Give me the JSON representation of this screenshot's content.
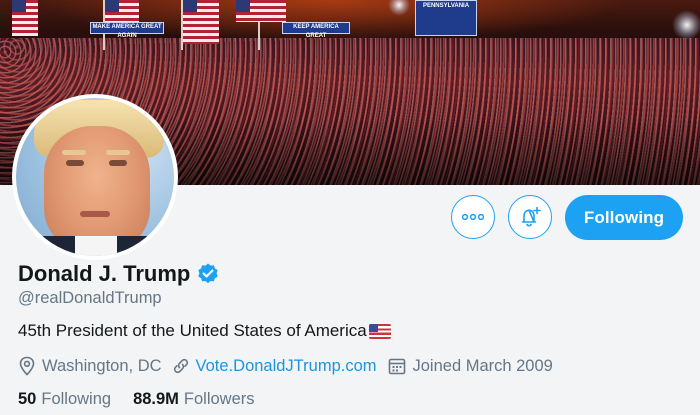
{
  "banner": {
    "signs": [
      "PENNSYLVANIA",
      "MAKE AMERICA GREAT AGAIN",
      "KEEP AMERICA GREAT"
    ]
  },
  "actions": {
    "more_icon": "more-dots-icon",
    "notify_icon": "bell-plus-icon",
    "following_label": "Following"
  },
  "profile": {
    "name": "Donald J. Trump",
    "verified_icon": "verified-badge-icon",
    "handle": "@realDonaldTrump",
    "bio": "45th President of the United States of America",
    "bio_emoji": "us-flag-emoji",
    "location": "Washington, DC",
    "website": "Vote.DonaldJTrump.com",
    "joined": "Joined March 2009"
  },
  "stats": {
    "following_count": "50",
    "following_label": "Following",
    "followers_count": "88.9M",
    "followers_label": "Followers"
  },
  "colors": {
    "accent": "#1da1f2",
    "link": "#1b95e0",
    "secondary_text": "#657786"
  }
}
